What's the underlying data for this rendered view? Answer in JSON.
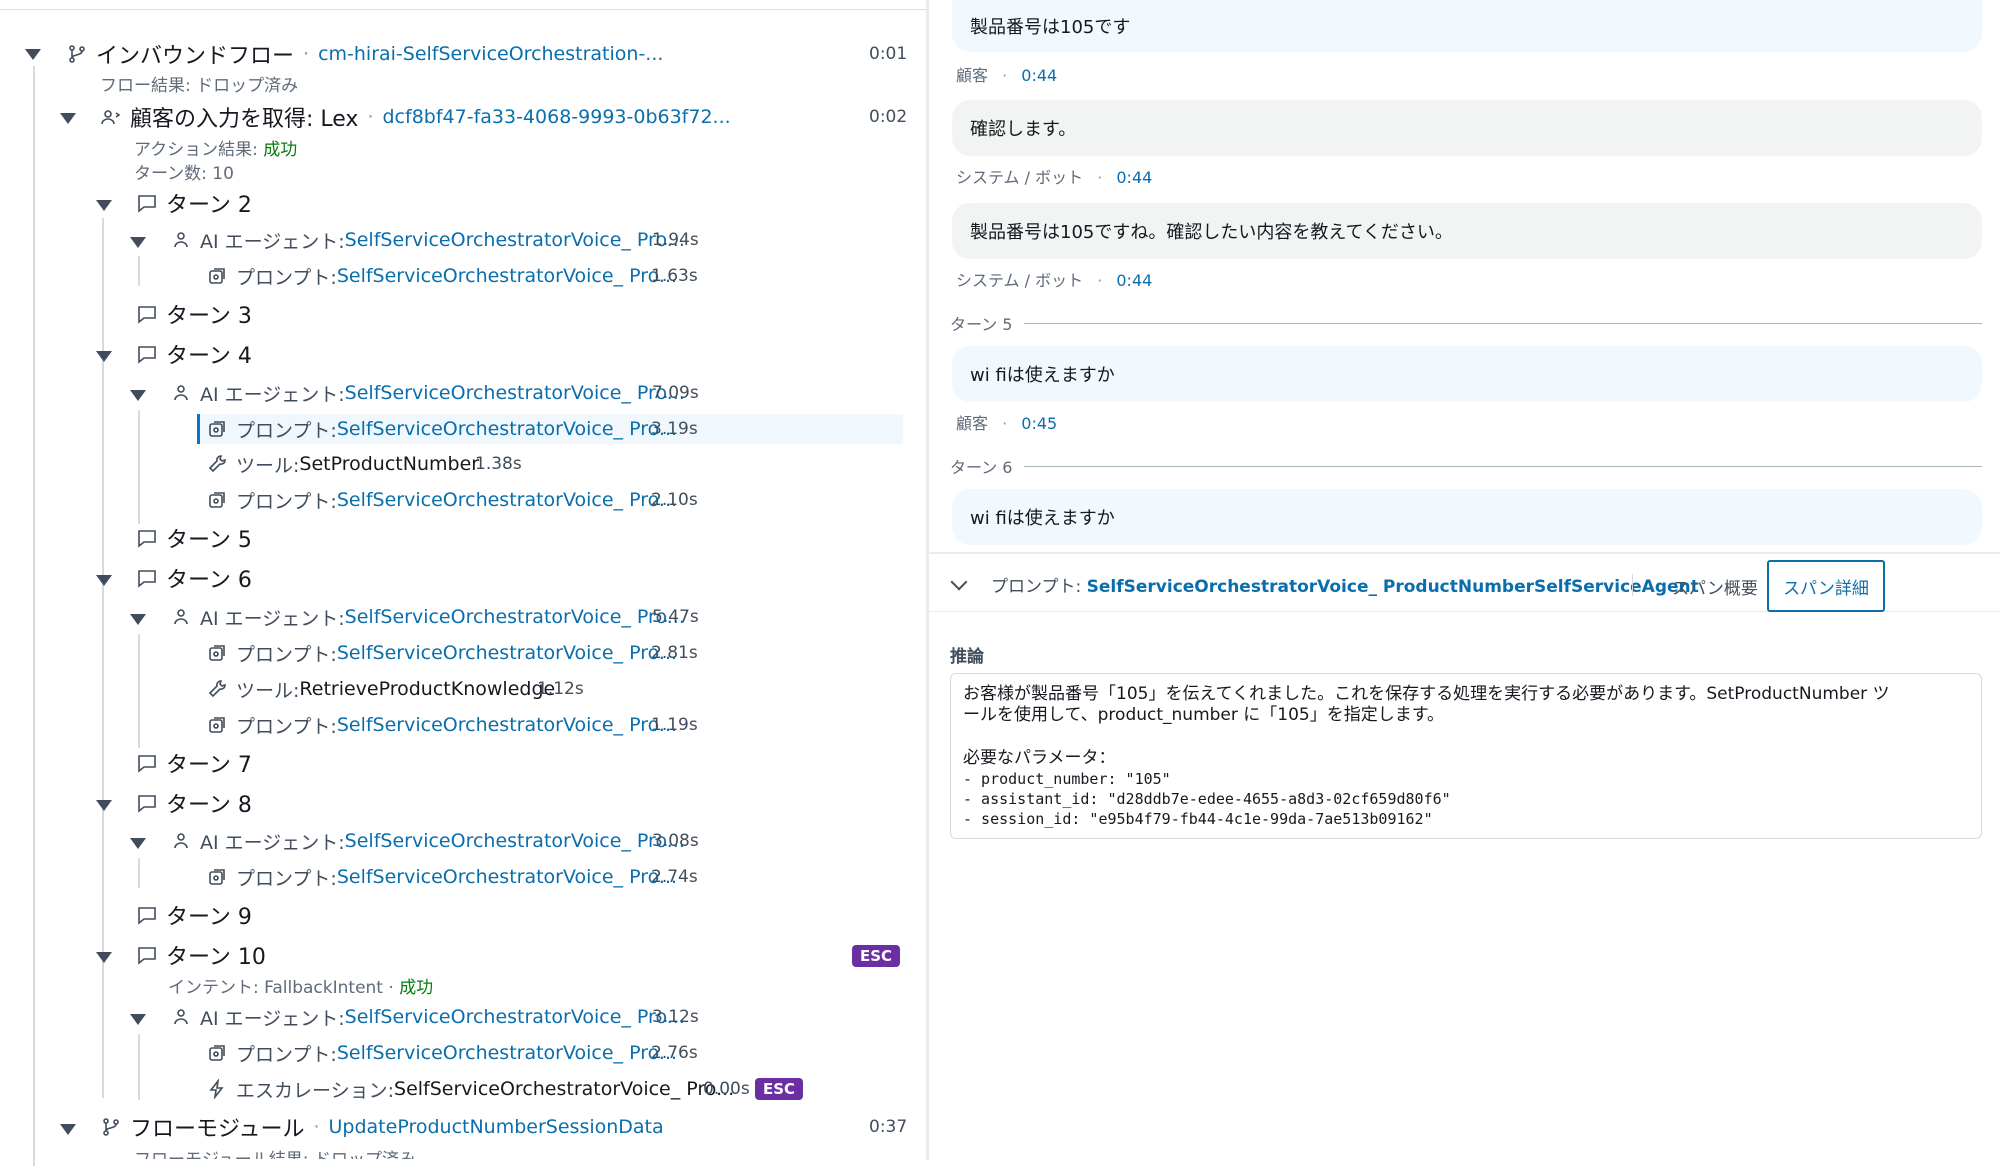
{
  "tree": {
    "inbound_flow": {
      "label": "インバウンドフロー",
      "link": "cm-hirai-SelfServiceOrchestration-...",
      "duration": "0:01",
      "result": "フロー結果: ドロップ済み"
    },
    "lex": {
      "label": "顧客の入力を取得: Lex",
      "link": "dcf8bf47-fa33-4068-9993-0b63f72...",
      "duration": "0:02",
      "action_result_label": "アクション結果: ",
      "action_result_value": "成功",
      "turn_count": "ターン数: 10"
    },
    "agent_label": "AI エージェント: ",
    "prompt_label": "プロンプト: ",
    "tool_label": "ツール: ",
    "escalation_label": "エスカレーション: ",
    "agent_name": "SelfServiceOrchestratorVoice_ Pro...",
    "esc_badge": "ESC",
    "turns": {
      "t2": {
        "label": "ターン 2",
        "agent_dur": "1.94s",
        "p1_dur": "1.63s"
      },
      "t3": {
        "label": "ターン 3"
      },
      "t4": {
        "label": "ターン 4",
        "agent_dur": "7.09s",
        "p1_dur": "3.19s",
        "tool_name": "SetProductNumber",
        "tool_dur": "1.38s",
        "p2_dur": "2.10s"
      },
      "t5": {
        "label": "ターン 5"
      },
      "t6": {
        "label": "ターン 6",
        "agent_dur": "5.47s",
        "p1_dur": "2.81s",
        "tool_name": "RetrieveProductKnowledge",
        "tool_dur": "1.12s",
        "p2_dur": "1.19s"
      },
      "t7": {
        "label": "ターン 7"
      },
      "t8": {
        "label": "ターン 8",
        "agent_dur": "3.08s",
        "p1_dur": "2.74s"
      },
      "t9": {
        "label": "ターン 9"
      },
      "t10": {
        "label": "ターン 10",
        "intent_label": "インテント: FallbackIntent · ",
        "intent_result": "成功",
        "agent_dur": "3.12s",
        "p1_dur": "2.76s",
        "esc_name": "SelfServiceOrchestratorVoice_ Pro...",
        "esc_dur": "0.00s"
      }
    },
    "flow_module": {
      "label": "フローモジュール",
      "link": "UpdateProductNumberSessionData",
      "duration": "0:37",
      "result": "フローモジュール結果: ドロップ済み"
    }
  },
  "transcript": {
    "m1": {
      "text": "製品番号は105です",
      "who": "顧客",
      "time": "0:44"
    },
    "m2": {
      "text": "確認します。",
      "who": "システム / ボット",
      "time": "0:44"
    },
    "m3": {
      "text": "製品番号は105ですね。確認したい内容を教えてください。",
      "who": "システム / ボット",
      "time": "0:44"
    },
    "turn5": "ターン 5",
    "m4": {
      "text": "wi fiは使えますか",
      "who": "顧客",
      "time": "0:45"
    },
    "turn6": "ターン 6",
    "m5": {
      "text": "wi fiは使えますか"
    },
    "sep": "·"
  },
  "detail": {
    "prompt_label": "プロンプト: ",
    "prompt_name": "SelfServiceOrchestratorVoice_ ProductNumberSelfServiceAgent",
    "tab_overview": "スパン概要",
    "tab_detail": "スパン詳細",
    "reasoning_title": "推論",
    "reasoning_line1": "お客様が製品番号「105」を伝えてくれました。これを保存する処理を実行する必要があります。SetProductNumber ツ",
    "reasoning_line2": "ールを使用して、product_number に「105」を指定します。",
    "params_title": "必要なパラメータ：",
    "param1": "- product_number: \"105\"",
    "param2": "- assistant_id: \"d28ddb7e-edee-4655-a8d3-02cf659d80f6\"",
    "param3": "- session_id: \"e95b4f79-fb44-4c1e-99da-7ae513b09162\""
  },
  "colors": {
    "link": "#0a6ead",
    "success": "#037f0c",
    "esc_badge": "#6b2fa3",
    "customer_bubble": "#f1f8fe",
    "bot_bubble": "#f2f3f3"
  }
}
